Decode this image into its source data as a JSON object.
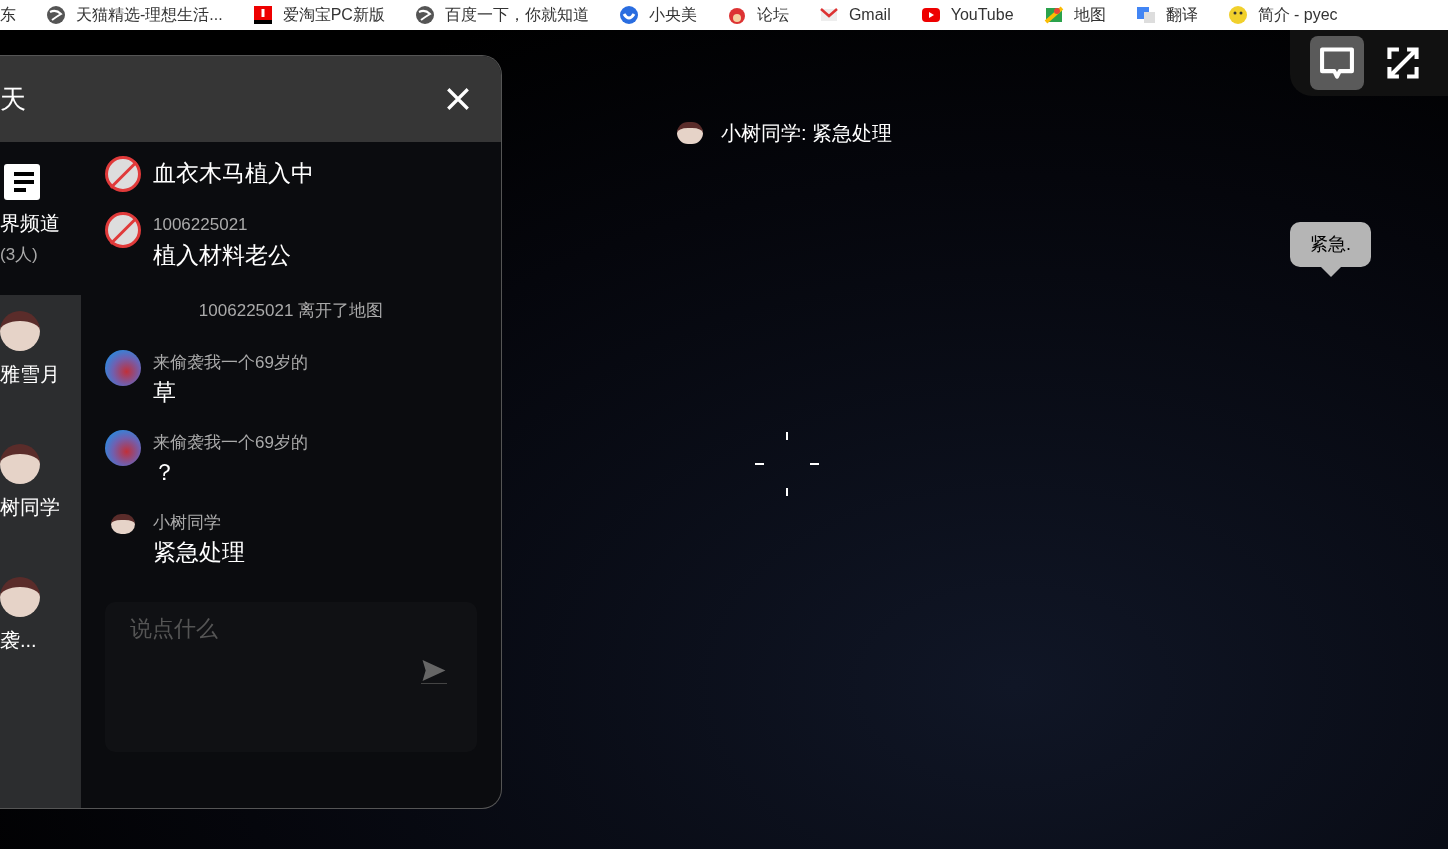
{
  "bookmarks": [
    {
      "label": "东",
      "kind": "plain"
    },
    {
      "label": "天猫精选-理想生活...",
      "kind": "globe"
    },
    {
      "label": "爱淘宝PC新版",
      "kind": "red"
    },
    {
      "label": "百度一下，你就知道",
      "kind": "globe"
    },
    {
      "label": "小央美",
      "kind": "blue"
    },
    {
      "label": "论坛",
      "kind": "mascot"
    },
    {
      "label": "Gmail",
      "kind": "mail"
    },
    {
      "label": "YouTube",
      "kind": "play"
    },
    {
      "label": "地图",
      "kind": "map"
    },
    {
      "label": "翻译",
      "kind": "translate"
    },
    {
      "label": "简介 - pyec",
      "kind": "smiley"
    }
  ],
  "chat_panel": {
    "title": "天",
    "channels": [
      {
        "kind": "channel",
        "label": "界频道",
        "count": "(3人)",
        "selected": true
      },
      {
        "kind": "user",
        "label": "雅雪月",
        "selected": false
      },
      {
        "kind": "user",
        "label": "树同学",
        "selected": false
      },
      {
        "kind": "user",
        "label": "袭...",
        "selected": false
      }
    ],
    "messages": [
      {
        "kind": "banned",
        "text": "血衣木马植入中"
      },
      {
        "kind": "banned",
        "sender": "1006225021",
        "text": "植入材料老公"
      },
      {
        "kind": "system",
        "text": "1006225021 离开了地图"
      },
      {
        "kind": "guest",
        "sender": "来偷袭我一个69岁的",
        "text": "草"
      },
      {
        "kind": "guest",
        "sender": "来偷袭我一个69岁的",
        "text": "？"
      },
      {
        "kind": "member",
        "sender": "小树同学",
        "text": "紧急处理"
      }
    ],
    "input": {
      "placeholder": "说点什么"
    }
  },
  "game": {
    "toolbar": [
      {
        "kind": "chat",
        "selected": true
      },
      {
        "kind": "fullscreen",
        "selected": false
      }
    ],
    "caption": "小树同学: 紧急处理",
    "speech_bubble": "紧急."
  }
}
